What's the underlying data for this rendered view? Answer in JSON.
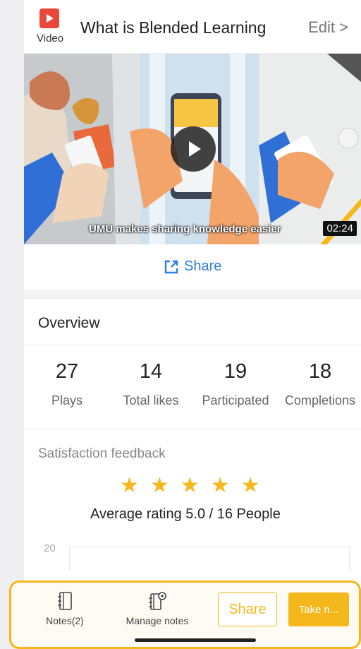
{
  "header": {
    "badge_label": "Video",
    "title": "What is Blended Learning",
    "edit_label": "Edit >"
  },
  "video": {
    "caption": "UMU makes sharing knowledge easier",
    "duration": "02:24"
  },
  "share": {
    "label": "Share"
  },
  "overview": {
    "title": "Overview",
    "stats": [
      {
        "value": "27",
        "label": "Plays"
      },
      {
        "value": "14",
        "label": "Total likes"
      },
      {
        "value": "19",
        "label": "Participated"
      },
      {
        "value": "18",
        "label": "Completions"
      }
    ]
  },
  "satisfaction": {
    "title": "Satisfaction feedback",
    "rating_stars": 5,
    "rating_max": 5,
    "average_text": "Average rating 5.0 / 16 People",
    "axis_top": "20"
  },
  "bottom_bar": {
    "notes_label": "Notes(2)",
    "manage_label": "Manage notes",
    "share_label": "Share",
    "take_label": "Take n..."
  },
  "colors": {
    "accent": "#f5b81c",
    "link": "#2f7ee0",
    "video_badge": "#e8473a"
  },
  "icons": {
    "video_badge": "play-icon",
    "share": "external-link-icon",
    "notes": "notebook-icon",
    "manage": "notebook-settings-icon"
  }
}
